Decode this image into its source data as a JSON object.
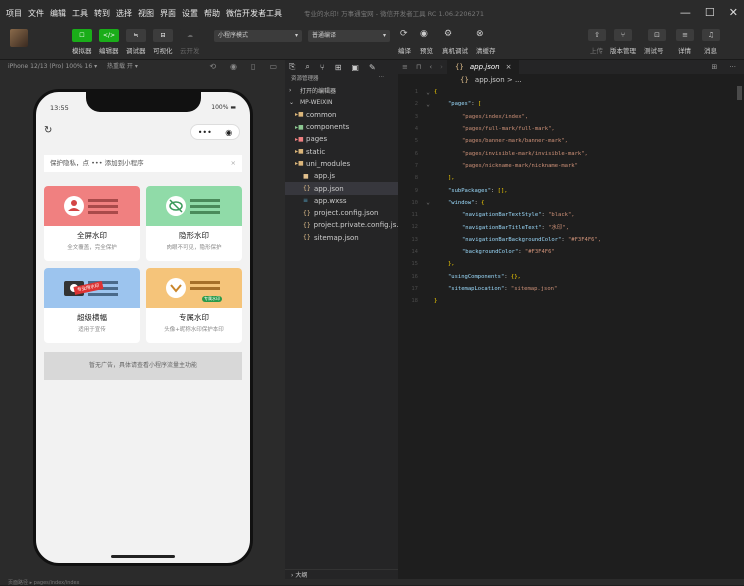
{
  "menubar": {
    "items": [
      "项目",
      "文件",
      "编辑",
      "工具",
      "转到",
      "选择",
      "视图",
      "界面",
      "设置",
      "帮助",
      "微信开发者工具"
    ],
    "window_title": "专业的水印! 万事通宝网 - 微信开发者工具 RC 1.06.2206271",
    "controls": [
      "—",
      "☐",
      "✕"
    ]
  },
  "toolbar": {
    "mode_buttons": [
      {
        "icon": "☐",
        "label": "模拟器",
        "color": "#1aad19"
      },
      {
        "icon": "</>",
        "label": "编辑器",
        "color": "#1aad19"
      },
      {
        "icon": "≒",
        "label": "调试器",
        "color": "#3c3c3c"
      },
      {
        "icon": "⊟",
        "label": "可视化",
        "color": "#3c3c3c"
      },
      {
        "icon": "☁",
        "label": "云开发",
        "color": "#2b2b2b"
      }
    ],
    "mode_select": "小程序模式",
    "compile_select": "普通编译",
    "actions": [
      "编译",
      "预览",
      "真机调试",
      "清缓存"
    ],
    "right_buttons": [
      "上传",
      "版本管理",
      "测试号",
      "详情",
      "消息"
    ]
  },
  "simulator": {
    "device": "iPhone 12/13 (Pro) 100% 16 ▾",
    "hotreload": "热重载 开 ▾",
    "phone": {
      "time": "13:55",
      "battery": "100%",
      "tip": "保护隐私，点 ••• 添加到小程序",
      "tip_close": "×",
      "cards": [
        {
          "title": "全屏水印",
          "sub": "全文覆盖，完全保护",
          "color": "#f08080"
        },
        {
          "title": "隐形水印",
          "sub": "肉眼不可见，隐形保护",
          "color": "#90dba8"
        },
        {
          "title": "超级横幅",
          "sub": "适用于宣传",
          "color": "#9cc4ee",
          "badge": "专业用水印"
        },
        {
          "title": "专属水印",
          "sub": "头像+昵称水印保护本印",
          "color": "#f5c47a",
          "badge": "专属水印"
        }
      ],
      "ad": "暂无广告，具体请查看小程序流量主功能"
    }
  },
  "explorer": {
    "header": "资源管理器",
    "more": "···",
    "open_editors": "打开的编辑器",
    "project": "MP-WEIXIN",
    "items": [
      {
        "name": "common",
        "type": "folder",
        "icon": "▸",
        "color": "#dcb67a"
      },
      {
        "name": "components",
        "type": "folder",
        "icon": "▸",
        "color": "#8dc891"
      },
      {
        "name": "pages",
        "type": "folder",
        "icon": "▸",
        "color": "#f08080"
      },
      {
        "name": "static",
        "type": "folder",
        "icon": "▸",
        "color": "#dcb67a"
      },
      {
        "name": "uni_modules",
        "type": "folder",
        "icon": "▸",
        "color": "#dcb67a"
      },
      {
        "name": "app.js",
        "type": "file",
        "icon": "JS",
        "color": "#e2c08d"
      },
      {
        "name": "app.json",
        "type": "file",
        "icon": "{}",
        "color": "#e2c08d",
        "active": true
      },
      {
        "name": "app.wxss",
        "type": "file",
        "icon": "≡",
        "color": "#519aba"
      },
      {
        "name": "project.config.json",
        "type": "file",
        "icon": "{}",
        "color": "#e2c08d"
      },
      {
        "name": "project.private.config.js...",
        "type": "file",
        "icon": "{}",
        "color": "#e2c08d"
      },
      {
        "name": "sitemap.json",
        "type": "file",
        "icon": "{}",
        "color": "#e2c08d"
      }
    ],
    "outline": "大纲"
  },
  "editor": {
    "tab": "app.json",
    "tab_close": "×",
    "breadcrumb": "app.json > ...",
    "code": [
      {
        "ln": "1",
        "fold": "⌄",
        "text": "{"
      },
      {
        "ln": "2",
        "fold": "⌄",
        "text": "\"pages\": ["
      },
      {
        "ln": "3",
        "fold": "",
        "text": "\"pages/index/index\","
      },
      {
        "ln": "4",
        "fold": "",
        "text": "\"pages/full-mark/full-mark\","
      },
      {
        "ln": "5",
        "fold": "",
        "text": "\"pages/banner-mark/banner-mark\","
      },
      {
        "ln": "6",
        "fold": "",
        "text": "\"pages/invisible-mark/invisible-mark\","
      },
      {
        "ln": "7",
        "fold": "",
        "text": "\"pages/nickname-mark/nickname-mark\""
      },
      {
        "ln": "8",
        "fold": "",
        "text": "],"
      },
      {
        "ln": "9",
        "fold": "",
        "text": "\"subPackages\": [],"
      },
      {
        "ln": "10",
        "fold": "⌄",
        "text": "\"window\": {"
      },
      {
        "ln": "11",
        "fold": "",
        "text": "\"navigationBarTextStyle\": \"black\","
      },
      {
        "ln": "12",
        "fold": "",
        "text": "\"navigationBarTitleText\": \"水印\","
      },
      {
        "ln": "13",
        "fold": "",
        "text": "\"navigationBarBackgroundColor\": \"#F3F4F6\","
      },
      {
        "ln": "14",
        "fold": "",
        "text": "\"backgroundColor\": \"#F3F4F6\""
      },
      {
        "ln": "15",
        "fold": "",
        "text": "},"
      },
      {
        "ln": "16",
        "fold": "",
        "text": "\"usingComponents\": {},"
      },
      {
        "ln": "17",
        "fold": "",
        "text": "\"sitemapLocation\": \"sitemap.json\""
      },
      {
        "ln": "18",
        "fold": "",
        "text": "}"
      }
    ]
  },
  "statusbar": {
    "path": "页面路径 ▸ pages/index/index"
  }
}
